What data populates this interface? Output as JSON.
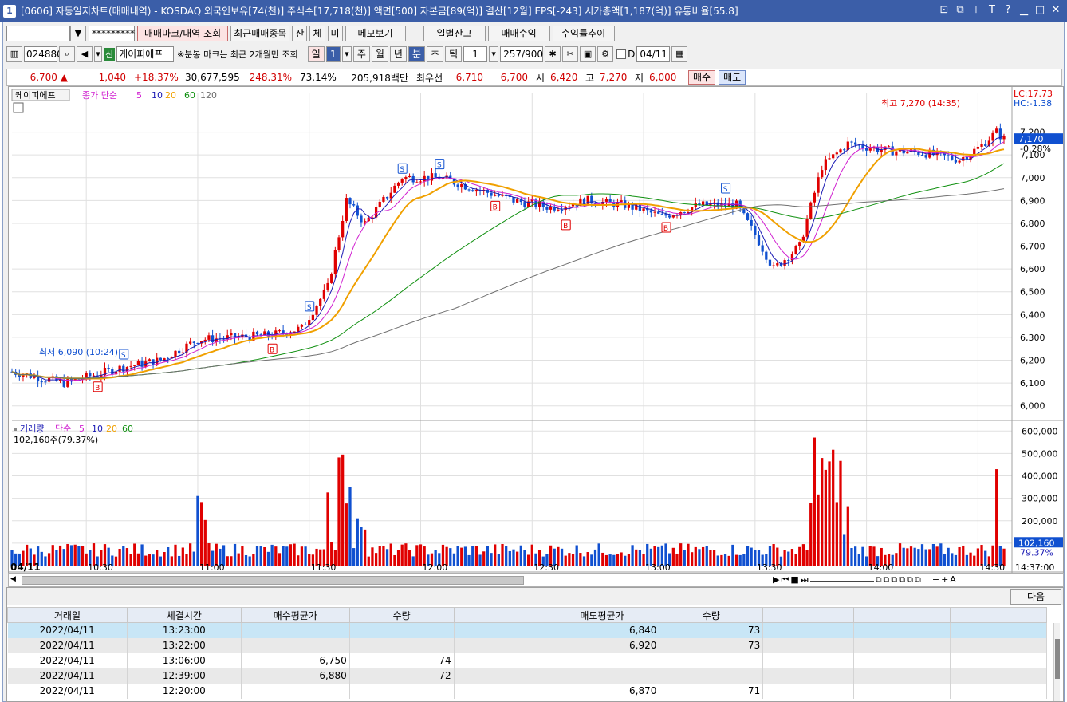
{
  "window": {
    "title_num": "1",
    "title": "[0606] 자동일지차트(매매내역) - KOSDAQ 외국인보유[74(천)] 주식수[17,718(천)] 액면[500] 자본금[89(억)] 결산[12월] EPS[-243] 시가총액[1,187(억)] 유통비율[55.8]"
  },
  "toolbar1": {
    "account_value": "",
    "password_value": "*********",
    "btn_mark": "매매마크/내역 조회",
    "btn_recent": "최근매매종목",
    "btn_jan": "잔",
    "btn_che": "체",
    "btn_mi": "미",
    "btn_memo": "메모보기",
    "btn_daily": "일별잔고",
    "btn_profit": "매매수익",
    "btn_return": "수익률추이"
  },
  "toolbar2": {
    "code": "024880",
    "badge": "신",
    "name": "케이피에프",
    "notice": "※분봉 마크는 최근 2개월만 조회",
    "period_day": "일",
    "period_num": "1",
    "p_week": "주",
    "p_month": "월",
    "p_year": "년",
    "p_min": "분",
    "p_sec": "초",
    "p_tick": "틱",
    "interval": "1",
    "count": "257/900",
    "d_label": "D",
    "date": "04/11"
  },
  "price": {
    "current": "6,700",
    "arrow": "▲",
    "change": "1,040",
    "change_pct": "+18.37%",
    "volume": "30,677,595",
    "vol_ratio": "248.31%",
    "turnover": "73.14%",
    "amount": "205,918백만",
    "pref_label": "최우선",
    "ask": "6,710",
    "bid": "6,700",
    "open_label": "시",
    "open": "6,420",
    "high_label": "고",
    "high": "7,270",
    "low_label": "저",
    "low": "6,000",
    "buy": "매수",
    "sell": "매도"
  },
  "chart": {
    "tab": "케이피에프",
    "legend_price": "종가 단순",
    "ma": [
      "5",
      "10",
      "20",
      "60",
      "120"
    ],
    "lc": "LC:17.73",
    "hc": "HC:-1.38",
    "high_note": "최고 7,270 (14:35)",
    "low_note": "최저 6,090 (10:24)",
    "last_price": "7,170",
    "last_pct": "-0.28%",
    "price_ticks": [
      "7,200",
      "7,100",
      "7,000",
      "6,900",
      "6,800",
      "6,700",
      "6,600",
      "6,500",
      "6,400",
      "6,300",
      "6,200",
      "6,100",
      "6,000"
    ],
    "vol_legend": "거래량",
    "vol_legend_type": "단순",
    "vol_summary": "102,160주(79.37%)",
    "vol_ticks": [
      "600,000",
      "500,000",
      "400,000",
      "300,000",
      "200,000",
      "100,000"
    ],
    "vol_last": "102,160",
    "vol_last_pct": "79.37%",
    "date_label": "04/11",
    "time_ticks": [
      "10:30",
      "11:00",
      "11:30",
      "12:00",
      "12:30",
      "13:00",
      "13:30",
      "14:00",
      "14:30"
    ],
    "last_time": "14:37:00"
  },
  "chart_data": {
    "type": "candlestick",
    "title": "",
    "xlabel": "",
    "ylabel": "",
    "ylim": [
      5950,
      7300
    ],
    "time_range": [
      "10:10",
      "14:37"
    ],
    "buy_marks_time": [
      "10:33",
      "11:20",
      "12:20",
      "12:39",
      "13:06"
    ],
    "sell_marks_time": [
      "10:40",
      "11:30",
      "11:55",
      "12:05",
      "13:22"
    ],
    "extrema": {
      "high": 7270,
      "high_time": "14:35",
      "low": 6090,
      "low_time": "10:24"
    }
  },
  "table": {
    "headers": [
      "거래일",
      "체결시간",
      "매수평균가",
      "수량",
      "",
      "매도평균가",
      "수량",
      "",
      "",
      ""
    ],
    "rows": [
      [
        "2022/04/11",
        "13:23:00",
        "",
        "",
        "",
        "6,840",
        "73",
        "",
        "",
        ""
      ],
      [
        "2022/04/11",
        "13:22:00",
        "",
        "",
        "",
        "6,920",
        "73",
        "",
        "",
        ""
      ],
      [
        "2022/04/11",
        "13:06:00",
        "6,750",
        "74",
        "",
        "",
        "",
        "",
        "",
        ""
      ],
      [
        "2022/04/11",
        "12:39:00",
        "6,880",
        "72",
        "",
        "",
        "",
        "",
        "",
        ""
      ],
      [
        "2022/04/11",
        "12:20:00",
        "",
        "",
        "",
        "6,870",
        "71",
        "",
        "",
        ""
      ]
    ],
    "next": "다음"
  },
  "colors": {
    "up": "#e00000",
    "down": "#1050d0",
    "ma5": "#1a1ab4",
    "ma10": "#d020d0",
    "ma20": "#f0a000",
    "ma60": "#109010",
    "ma120": "#707070"
  }
}
